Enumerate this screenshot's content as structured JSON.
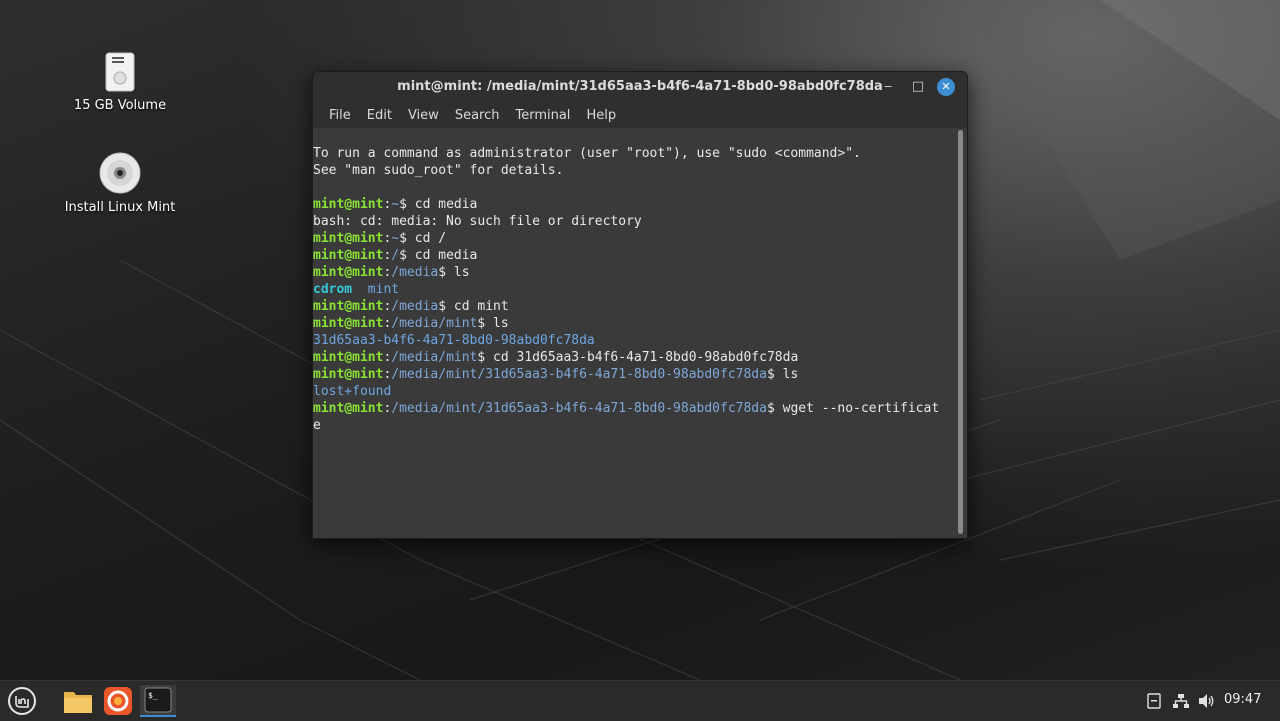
{
  "desktop": {
    "icons": [
      {
        "label": "15 GB Volume",
        "icon": "drive-icon"
      },
      {
        "label": "Install Linux Mint",
        "icon": "disc-icon"
      }
    ]
  },
  "window": {
    "title": "mint@mint: /media/mint/31d65aa3-b4f6-4a71-8bd0-98abd0fc78da",
    "controls": {
      "minimize": "‒",
      "maximize": "□",
      "close": "✕"
    },
    "menu": [
      "File",
      "Edit",
      "View",
      "Search",
      "Terminal",
      "Help"
    ]
  },
  "terminal": {
    "user": "mint@mint",
    "lines": {
      "l1": "To run a command as administrator (user \"root\"), use \"sudo <command>\".",
      "l2": "See \"man sudo_root\" for details.",
      "c1_path": "~",
      "c1_cmd": "$ cd media",
      "o1": "bash: cd: media: No such file or directory",
      "c2_path": "~",
      "c2_cmd": "$ cd /",
      "c3_path": "/",
      "c3_cmd": "$ cd media",
      "c4_path": "/media",
      "c4_cmd": "$ ls",
      "o4_a": "cdrom",
      "o4_b": "mint",
      "c5_path": "/media",
      "c5_cmd": "$ cd mint",
      "c6_path": "/media/mint",
      "c6_cmd": "$ ls",
      "o6": "31d65aa3-b4f6-4a71-8bd0-98abd0fc78da",
      "c7_path": "/media/mint",
      "c7_cmd": "$ cd 31d65aa3-b4f6-4a71-8bd0-98abd0fc78da",
      "c8_path": "/media/mint/31d65aa3-b4f6-4a71-8bd0-98abd0fc78da",
      "c8_cmd": "$ ls",
      "o8": "lost+found",
      "c9_path": "/media/mint/31d65aa3-b4f6-4a71-8bd0-98abd0fc78da",
      "c9_cmd": "$ wget --no-certificat",
      "c9_wrap": "e"
    }
  },
  "taskbar": {
    "apps": [
      "menu-icon",
      "files-icon",
      "firefox-icon",
      "terminal-icon"
    ],
    "tray": [
      "notes-icon",
      "network-icon",
      "volume-icon"
    ],
    "clock": "09:47"
  }
}
